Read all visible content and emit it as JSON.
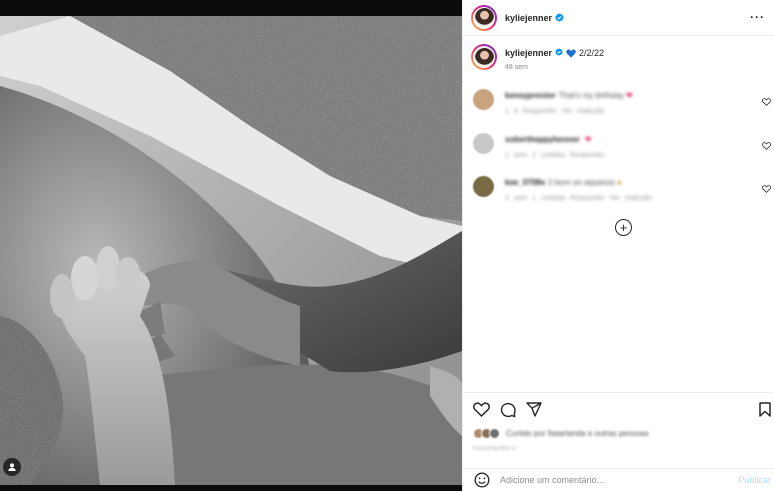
{
  "post": {
    "username": "kyliejenner",
    "caption_user": "kyliejenner",
    "caption_text": "2/2/22",
    "caption_time": "48 sem"
  },
  "comments": [
    {
      "user": "kensyproctor",
      "text": "That's my birthday",
      "meta": "1 d   Responder   Ver tradução",
      "avatar_color": "#c9a27e"
    },
    {
      "user": "sobertheppyhenner",
      "text": "",
      "meta": "1 sem   2 curtidas   Responder",
      "avatar_color": "#c8c8c8"
    },
    {
      "user": "kee_0708e",
      "text": "2 born on aquarius",
      "meta": "3 sem   1 curtidas   Responder   Ver tradução",
      "avatar_color": "#7a6a45"
    }
  ],
  "likes": {
    "text": "Curtido por fiatartanda e outras pessoas"
  },
  "date_text": "FEVEREIRO 2",
  "composer": {
    "placeholder": "Adicione um comentário...",
    "post_label": "Publicar"
  },
  "icons": {
    "verified": "verified-badge-icon",
    "more": "more-options-icon",
    "heart": "heart-icon",
    "comment": "comment-icon",
    "share": "share-icon",
    "save": "bookmark-icon",
    "emoji": "emoji-icon",
    "load_more": "plus-circle-icon",
    "tag": "user-tag-icon"
  },
  "colors": {
    "verified_blue": "#0095f6",
    "red_heart": "#e0245e",
    "blue_heart": "#1d6fd1",
    "post_button": "#b3dbff"
  }
}
